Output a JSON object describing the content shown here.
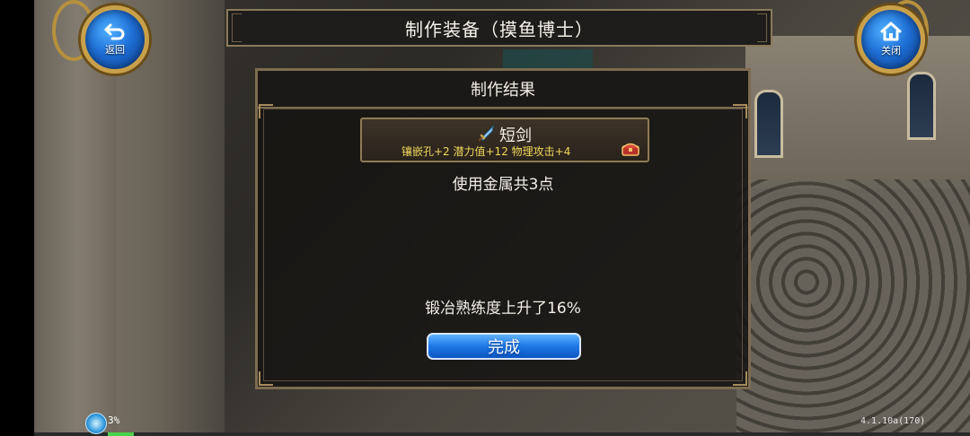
{
  "window": {
    "title": "制作装备（摸鱼博士）"
  },
  "top_buttons": {
    "back_label": "返回",
    "close_label": "关闭"
  },
  "dialog": {
    "header": "制作结果",
    "item": {
      "name": "短剑",
      "icon": "sword-icon",
      "stats": "镶嵌孔+2 潜力值+12 物理攻击+4",
      "chest_icon": "treasure-chest-icon"
    },
    "metal_used": "使用金属共3点",
    "skill_gain": "锻冶熟练度上升了16%",
    "done_label": "完成"
  },
  "status": {
    "percent_label": "3%",
    "progress_fraction": 0.03,
    "version": "4.1.10a(170)"
  },
  "colors": {
    "accent_blue": "#1d78e6",
    "gold_border": "#c9a04a",
    "stat_yellow": "#f0d85a"
  }
}
